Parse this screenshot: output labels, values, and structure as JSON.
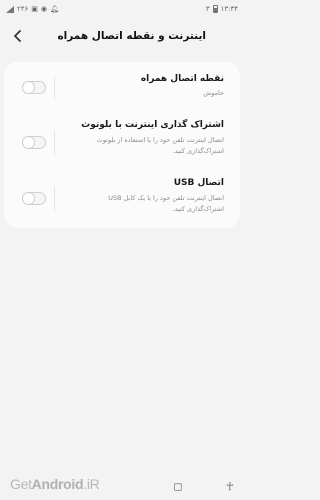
{
  "status_bar": {
    "time": "۱۳:۳۴",
    "left_text": "۲۴۶",
    "indicator": "۳"
  },
  "header": {
    "title": "اینترنت و نقطه اتصال همراه"
  },
  "items": [
    {
      "title": "نقطه اتصال همراه",
      "subtitle": "خاموش",
      "enabled": false
    },
    {
      "title": "اشتراک گذاری اینترنت با بلوتوث",
      "subtitle": "اتصال اینترنت تلفن خود را با استفاده از بلوتوث اشتراک‌گذاری کنید.",
      "enabled": false
    },
    {
      "title": "اتصال USB",
      "subtitle": "اتصال اینترنت تلفن خود را با یک کابل USB اشتراک‌گذاری کنید.",
      "enabled": false
    }
  ],
  "watermark": {
    "prefix": "Get",
    "brand": "Android",
    "suffix": ".iR"
  }
}
